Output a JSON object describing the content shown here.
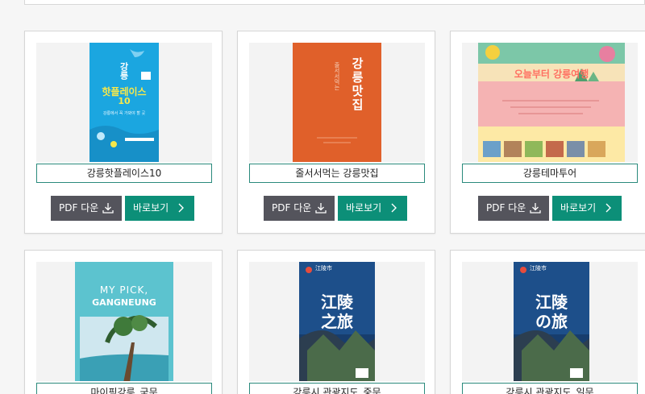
{
  "cards": [
    {
      "caption": "강릉핫플레이스10",
      "pdf_label": "PDF 다운",
      "view_label": "바로보기",
      "cover": {
        "title_line1": "핫플레이스",
        "title_line2": "10",
        "vertical": "강릉",
        "subtitle": "강릉에서 꼭 가봐야 할 곳"
      }
    },
    {
      "caption": "줄서서먹는 강릉맛집",
      "pdf_label": "PDF 다운",
      "view_label": "바로보기",
      "cover": {
        "title": "강릉맛집",
        "sub": "줄서서먹는"
      }
    },
    {
      "caption": "강릉테마투어",
      "pdf_label": "PDF 다운",
      "view_label": "바로보기",
      "cover": {
        "title": "오늘부터 강릉여행"
      }
    },
    {
      "caption": "마이픽강릉_국문",
      "cover": {
        "line1": "MY PICK,",
        "line2": "GANGNEUNG"
      }
    },
    {
      "caption": "강릉시 관광지도_중문",
      "cover": {
        "brand": "江陵市",
        "title_line1": "江陵",
        "title_line2": "之旅"
      }
    },
    {
      "caption": "강릉시 관광지도_일문",
      "cover": {
        "brand": "江陵市",
        "title_line1": "江陵",
        "title_line2": "の旅"
      }
    }
  ],
  "colors": {
    "pdf_button": "#54545c",
    "view_button": "#0c8f78",
    "caption_border": "#2a8a7c"
  },
  "icons": {
    "download": "download-icon",
    "arrow": "chevron-right-icon"
  }
}
